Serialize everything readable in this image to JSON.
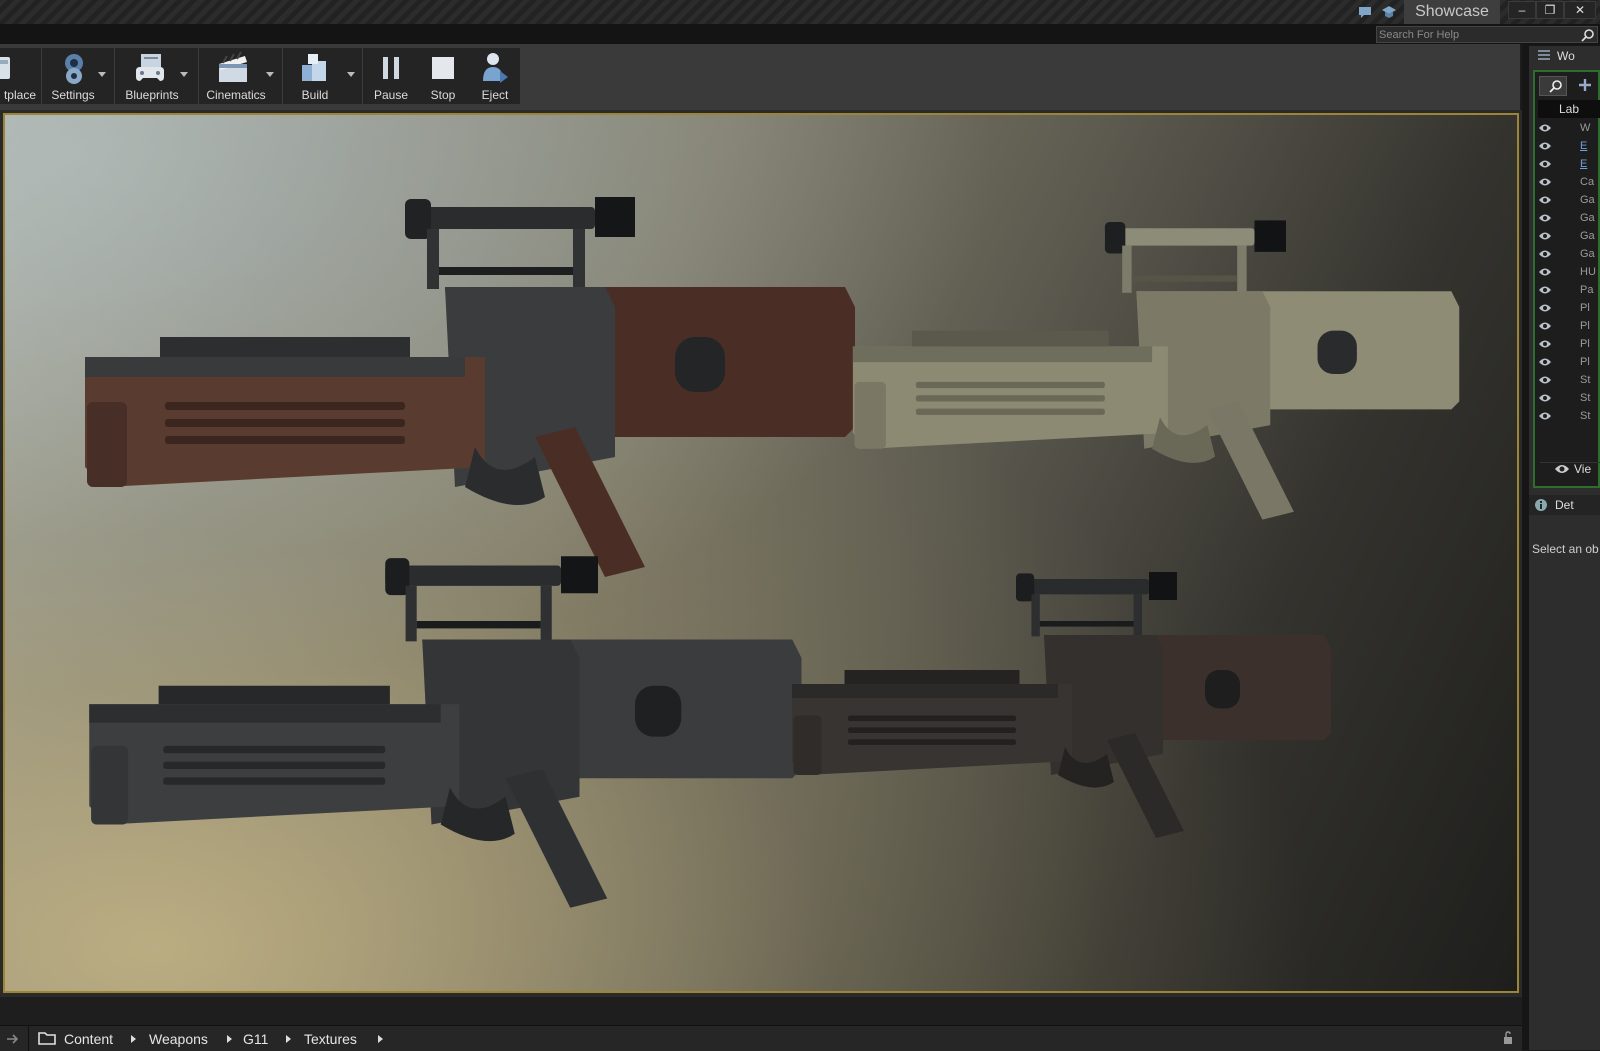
{
  "titlebar": {
    "project_name": "Showcase",
    "icons": [
      "chat-bubble-icon",
      "learn-cap-icon"
    ],
    "window_buttons": [
      "minimize",
      "restore",
      "close"
    ]
  },
  "search": {
    "placeholder": "Search For Help"
  },
  "toolbar": {
    "buttons": [
      {
        "label": "tplace",
        "icon": "marketplace-icon",
        "dropdown": false
      },
      {
        "label": "Settings",
        "icon": "settings-gears-icon",
        "dropdown": true
      },
      {
        "label": "Blueprints",
        "icon": "blueprints-gamepad-icon",
        "dropdown": true
      },
      {
        "label": "Cinematics",
        "icon": "cinematics-clapper-icon",
        "dropdown": true
      },
      {
        "label": "Build",
        "icon": "build-blocks-icon",
        "dropdown": true
      },
      {
        "label": "Pause",
        "icon": "pause-icon",
        "dropdown": false
      },
      {
        "label": "Stop",
        "icon": "stop-icon",
        "dropdown": false
      },
      {
        "label": "Eject",
        "icon": "eject-person-icon",
        "dropdown": false
      }
    ]
  },
  "viewport": {
    "subject": "four G11 rifle variants",
    "variants": [
      "wood-brown",
      "olive-tan",
      "dark-grey",
      "dark-brown"
    ],
    "border_color": "#9c8535"
  },
  "content_browser": {
    "breadcrumb": [
      "Content",
      "Weapons",
      "G11",
      "Textures"
    ]
  },
  "world_outliner": {
    "tab_label": "Wo",
    "column_header": "Lab",
    "rows": [
      "W",
      "E",
      "E",
      "Ca",
      "Ga",
      "Ga",
      "Ga",
      "Ga",
      "HU",
      "Pa",
      "Pl",
      "Pl",
      "Pl",
      "Pl",
      "St",
      "St",
      "St"
    ],
    "view_options_label": "Vie",
    "accent_color": "#2e6d2e"
  },
  "details": {
    "tab_label": "Det",
    "empty_message": "Select an ob"
  }
}
